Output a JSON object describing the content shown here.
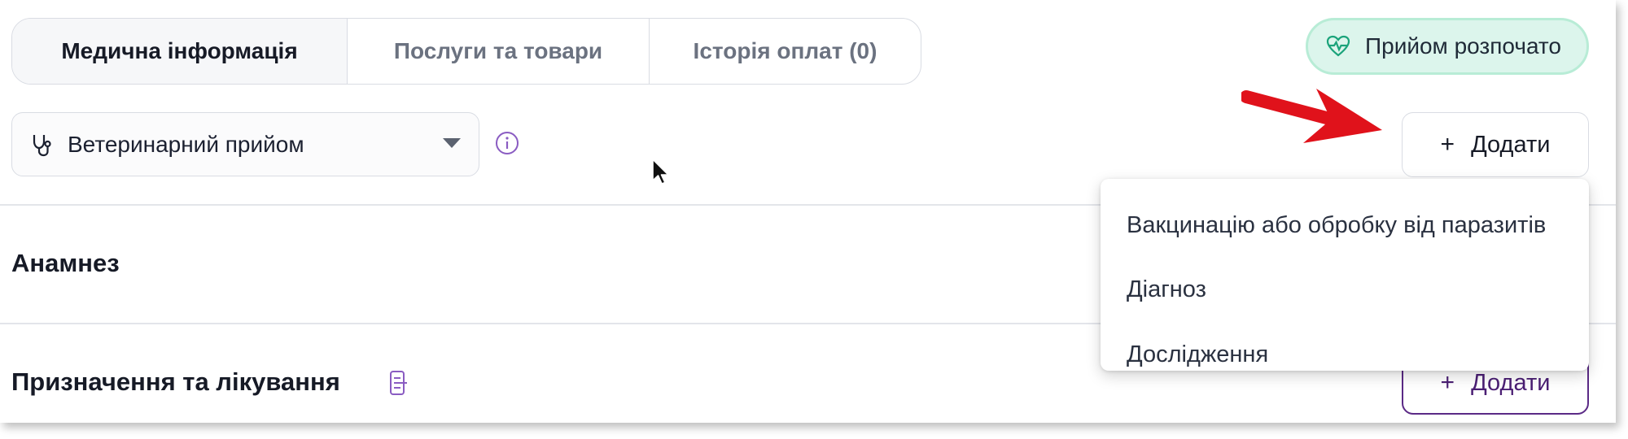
{
  "tabs": [
    {
      "label": "Медична інформація",
      "active": true
    },
    {
      "label": "Послуги та товари",
      "active": false
    },
    {
      "label": "Історія оплат (0)",
      "active": false
    }
  ],
  "status": {
    "label": "Прийом розпочато",
    "icon": "heartbeat-icon",
    "color": "#dcf5ec"
  },
  "visit_type": {
    "value": "Ветеринарний прийом",
    "icon": "stethoscope-icon"
  },
  "toolbar": {
    "add_label": "Додати",
    "add_icon": "plus-icon"
  },
  "add_menu": {
    "items": [
      "Вакцинацію або обробку від паразитів",
      "Діагноз",
      "Дослідження"
    ]
  },
  "sections": {
    "anamnesis": {
      "title": "Анамнез"
    },
    "treatment": {
      "title": "Призначення та лікування",
      "add_label": "Додати"
    }
  },
  "colors": {
    "accent": "#5b2a86",
    "annotation_arrow": "#e0121b"
  }
}
